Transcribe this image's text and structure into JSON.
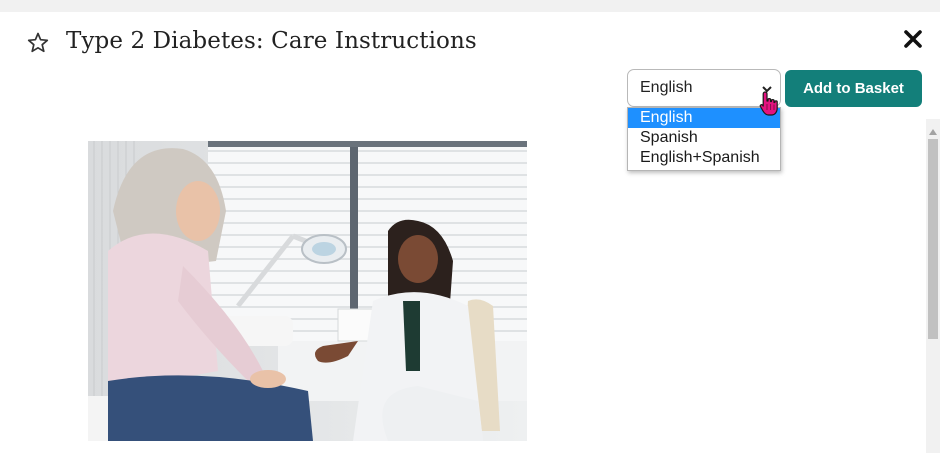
{
  "header": {
    "title": "Type 2 Diabetes: Care Instructions",
    "favorite_icon": "star-outline-icon",
    "close_icon": "close-x-icon"
  },
  "language_select": {
    "selected": "English",
    "options": [
      "English",
      "Spanish",
      "English+Spanish"
    ],
    "highlighted_index": 0
  },
  "actions": {
    "add_to_basket_label": "Add to Basket"
  },
  "image": {
    "name": "doctor-patient-consultation-photo"
  },
  "colors": {
    "accent": "#137f7a",
    "highlight": "#1e90ff",
    "cursor": "#e4127f"
  }
}
